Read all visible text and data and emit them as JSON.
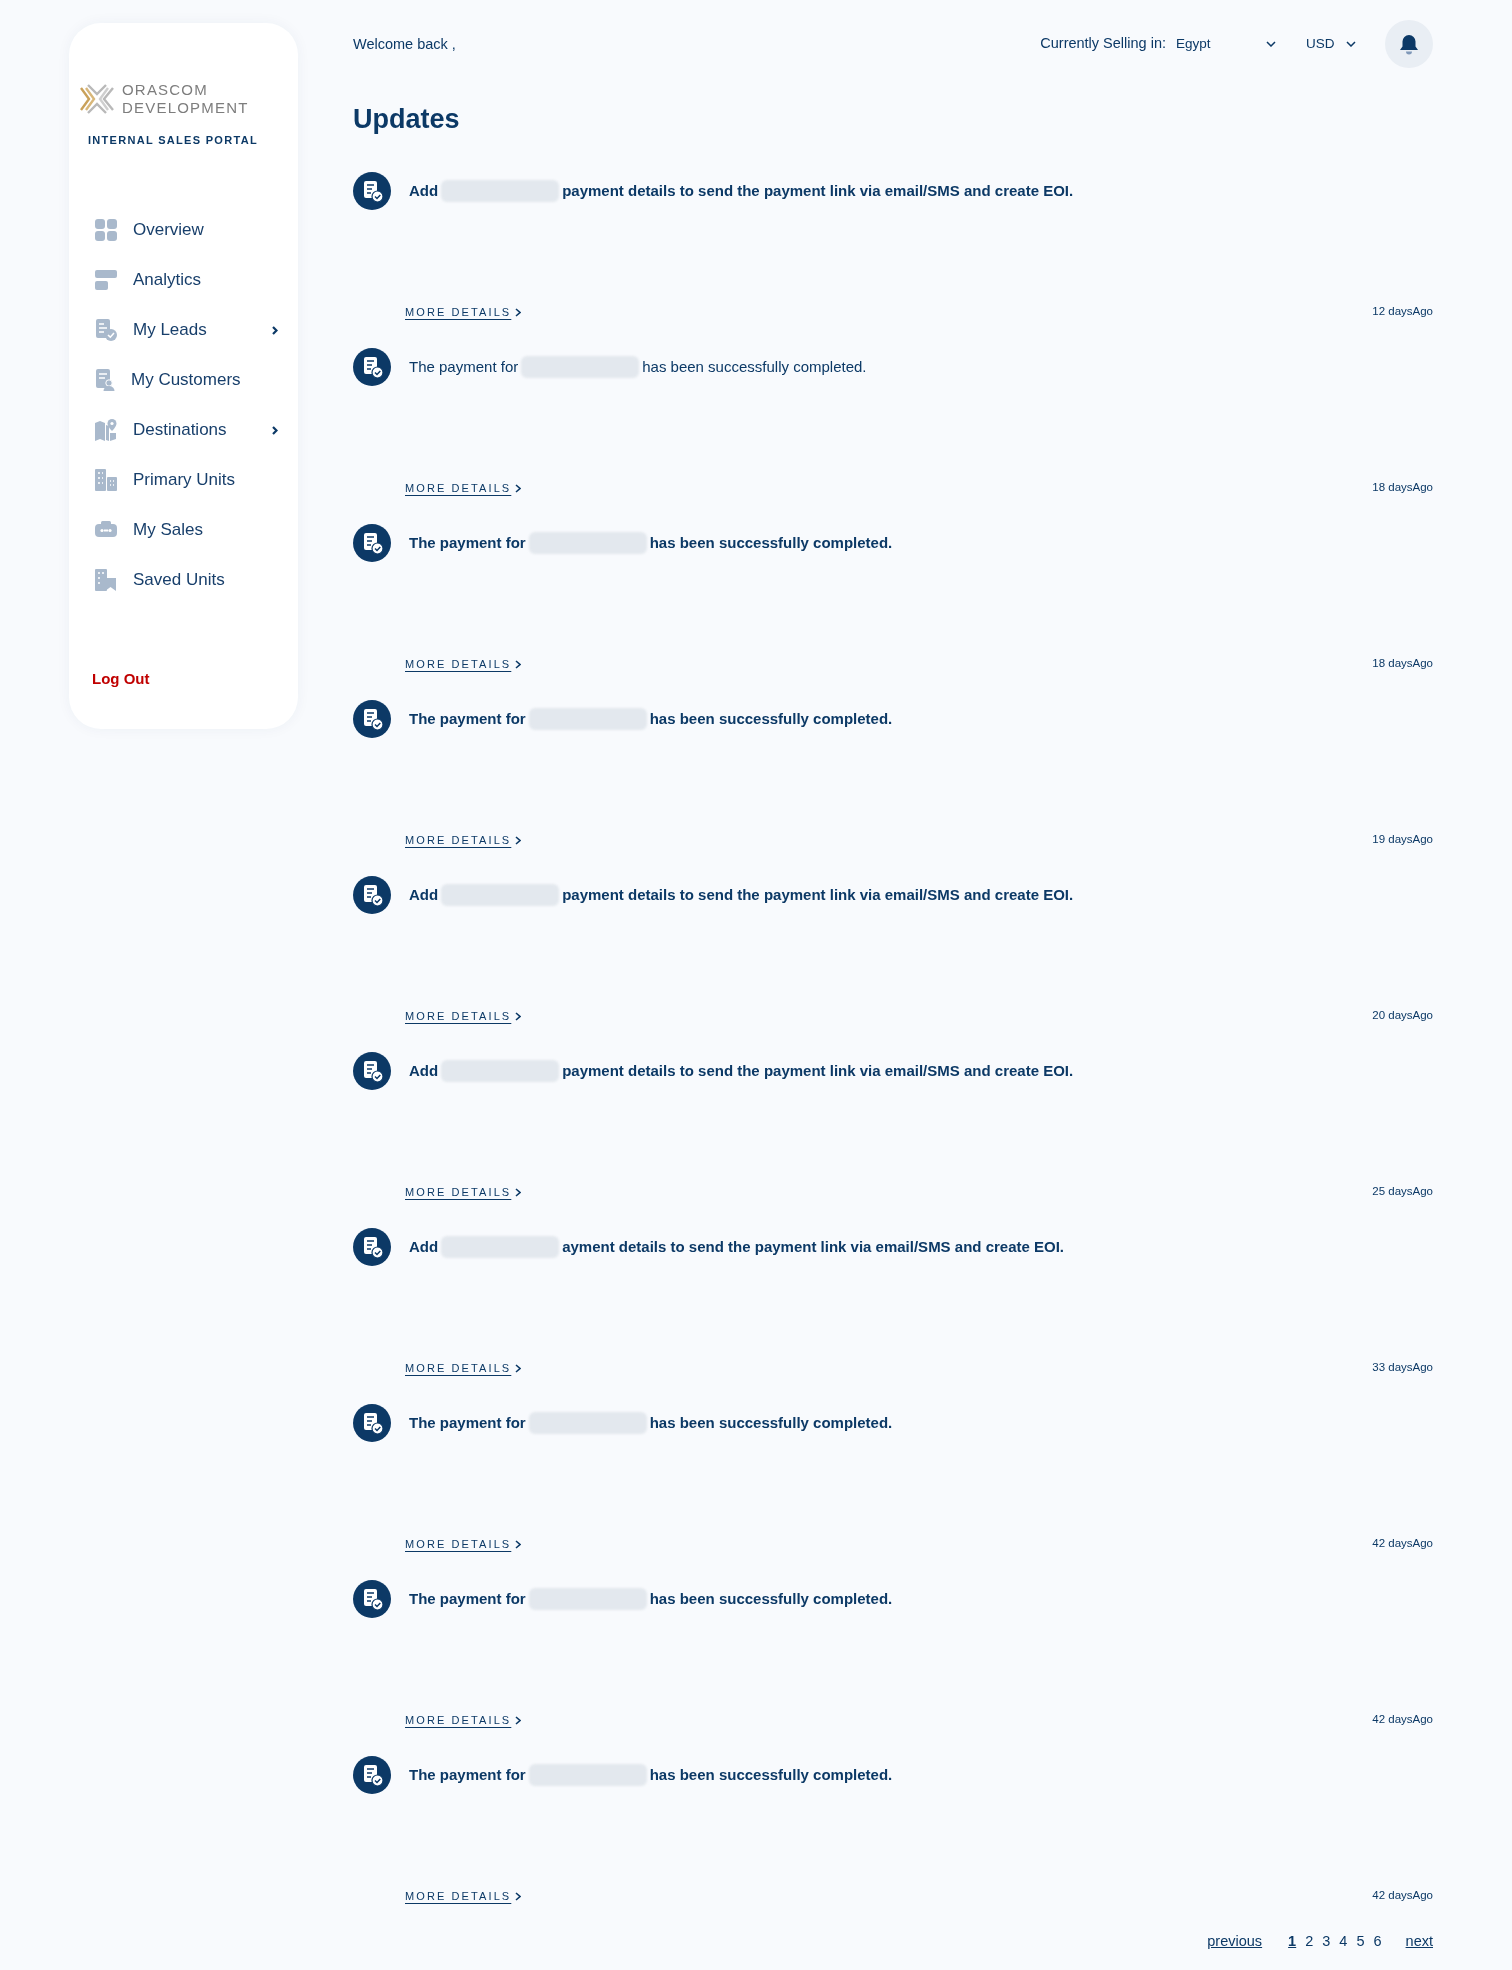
{
  "sidebar": {
    "logo": {
      "line_1": "ORASCOM",
      "line_2": "DEVELOPMENT"
    },
    "subtitle": "INTERNAL SALES PORTAL",
    "items": [
      {
        "label": "Overview",
        "has_submenu": false
      },
      {
        "label": "Analytics",
        "has_submenu": false
      },
      {
        "label": "My Leads",
        "has_submenu": true
      },
      {
        "label": "My Customers",
        "has_submenu": false
      },
      {
        "label": "Destinations",
        "has_submenu": true
      },
      {
        "label": "Primary Units",
        "has_submenu": false
      },
      {
        "label": "My Sales",
        "has_submenu": false
      },
      {
        "label": "Saved Units",
        "has_submenu": false
      }
    ],
    "logout": "Log Out"
  },
  "header": {
    "greeting": "Welcome back ,",
    "selling_label": "Currently Selling in:",
    "country": "Egypt",
    "currency": "USD"
  },
  "title": "Updates",
  "updates": [
    {
      "unread": true,
      "text_before": "Add",
      "redacted": true,
      "text_after": "payment details to send the payment link via email/SMS and create EOI.",
      "link": "MORE DETAILS",
      "time": "12 daysAgo"
    },
    {
      "unread": false,
      "text_before": "The payment for",
      "redacted": true,
      "text_after": "has been successfully completed.",
      "link": "MORE DETAILS",
      "time": "18 daysAgo"
    },
    {
      "unread": true,
      "text_before": "The payment for",
      "redacted": true,
      "text_after": "has been successfully completed.",
      "link": "MORE DETAILS",
      "time": "18 daysAgo"
    },
    {
      "unread": true,
      "text_before": "The payment for",
      "redacted": true,
      "text_after": "has been successfully completed.",
      "link": "MORE DETAILS",
      "time": "19 daysAgo"
    },
    {
      "unread": true,
      "text_before": "Add",
      "redacted": true,
      "text_after": "payment details to send the payment link via email/SMS and create EOI.",
      "link": "MORE DETAILS",
      "time": "20 daysAgo"
    },
    {
      "unread": true,
      "text_before": "Add",
      "redacted": true,
      "text_after": "payment details to send the payment link via email/SMS and create EOI.",
      "link": "MORE DETAILS",
      "time": "25 daysAgo"
    },
    {
      "unread": true,
      "text_before": "Add",
      "redacted": true,
      "text_after": "ayment details to send the payment link via email/SMS and create EOI.",
      "link": "MORE DETAILS",
      "time": "33 daysAgo"
    },
    {
      "unread": true,
      "text_before": "The payment for",
      "redacted": true,
      "text_after": "has been successfully completed.",
      "link": "MORE DETAILS",
      "time": "42 daysAgo"
    },
    {
      "unread": true,
      "text_before": "The payment for",
      "redacted": true,
      "text_after": "has been successfully completed.",
      "link": "MORE DETAILS",
      "time": "42 daysAgo"
    },
    {
      "unread": true,
      "text_before": "The payment for",
      "redacted": true,
      "text_after": "has been successfully completed.",
      "link": "MORE DETAILS",
      "time": "42 daysAgo"
    }
  ],
  "pagination": {
    "previous": "previous",
    "pages": [
      {
        "label": "1",
        "selected": true
      },
      {
        "label": "2",
        "selected": false
      },
      {
        "label": "3",
        "selected": false
      },
      {
        "label": "4",
        "selected": false
      },
      {
        "label": "5",
        "selected": false
      },
      {
        "label": "6",
        "selected": false
      }
    ],
    "next": "next"
  }
}
